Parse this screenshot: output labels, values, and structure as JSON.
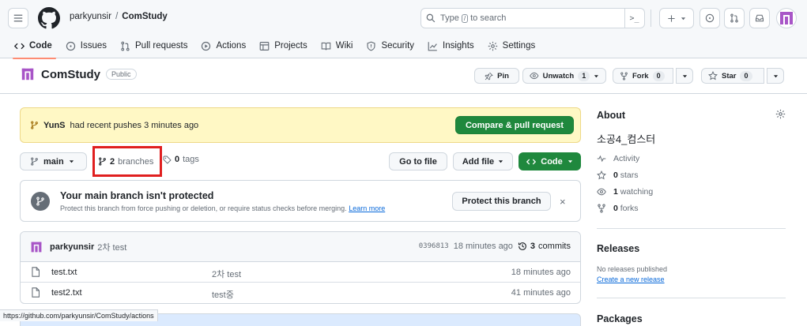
{
  "header": {
    "owner": "parkyunsir",
    "separator": "/",
    "repo": "ComStudy",
    "search": {
      "prefix": "Type",
      "kbd": "/",
      "suffix": "to search"
    },
    "command_palette": ">_",
    "icons": [
      "menu-icon",
      "github-logo",
      "search-icon",
      "plus-icon",
      "issue-icon",
      "pull-request-icon",
      "inbox-icon",
      "avatar"
    ]
  },
  "tabs": [
    {
      "label": "Code",
      "icon": "code-icon",
      "selected": true
    },
    {
      "label": "Issues",
      "icon": "issue-icon"
    },
    {
      "label": "Pull requests",
      "icon": "pull-request-icon"
    },
    {
      "label": "Actions",
      "icon": "play-icon"
    },
    {
      "label": "Projects",
      "icon": "table-icon"
    },
    {
      "label": "Wiki",
      "icon": "book-icon"
    },
    {
      "label": "Security",
      "icon": "shield-icon"
    },
    {
      "label": "Insights",
      "icon": "graph-icon"
    },
    {
      "label": "Settings",
      "icon": "gear-icon"
    }
  ],
  "repo": {
    "name": "ComStudy",
    "visibility": "Public",
    "pin_label": "Pin",
    "watch_label": "Unwatch",
    "watch_count": "1",
    "fork_label": "Fork",
    "fork_count": "0",
    "star_label": "Star",
    "star_count": "0"
  },
  "push_banner": {
    "user": "YunS",
    "text": "had recent pushes 3 minutes ago",
    "button": "Compare & pull request"
  },
  "branch_bar": {
    "branch": "main",
    "branches_count": "2",
    "branches_label": "branches",
    "tags_count": "0",
    "tags_label": "tags",
    "goto_file": "Go to file",
    "add_file": "Add file",
    "code": "Code"
  },
  "protect": {
    "title": "Your main branch isn't protected",
    "description": "Protect this branch from force pushing or deletion, or require status checks before merging.",
    "learn_more": "Learn more",
    "button": "Protect this branch",
    "close": "×"
  },
  "latest_commit": {
    "author": "parkyunsir",
    "message": "2차 test",
    "sha": "0396813",
    "age": "18 minutes ago",
    "commits_count": "3",
    "commits_label": "commits"
  },
  "files": [
    {
      "name": "test.txt",
      "message": "2차 test",
      "age": "18 minutes ago"
    },
    {
      "name": "test2.txt",
      "message": "test중",
      "age": "41 minutes ago"
    }
  ],
  "about": {
    "title": "About",
    "description": "소공4_컴스터",
    "activity": "Activity",
    "stars_count": "0",
    "stars_label": "stars",
    "watching_count": "1",
    "watching_label": "watching",
    "forks_count": "0",
    "forks_label": "forks"
  },
  "releases": {
    "title": "Releases",
    "none": "No releases published",
    "create": "Create a new release"
  },
  "packages": {
    "title": "Packages"
  },
  "status_bar": {
    "url": "https://github.com/parkyunsir/ComStudy/actions"
  },
  "colors": {
    "primary_green": "#1f883d",
    "banner_yellow": "#fff8c5",
    "link_blue": "#0969da",
    "tab_underline": "#fd8c73",
    "highlight_red": "#e01f1f"
  }
}
